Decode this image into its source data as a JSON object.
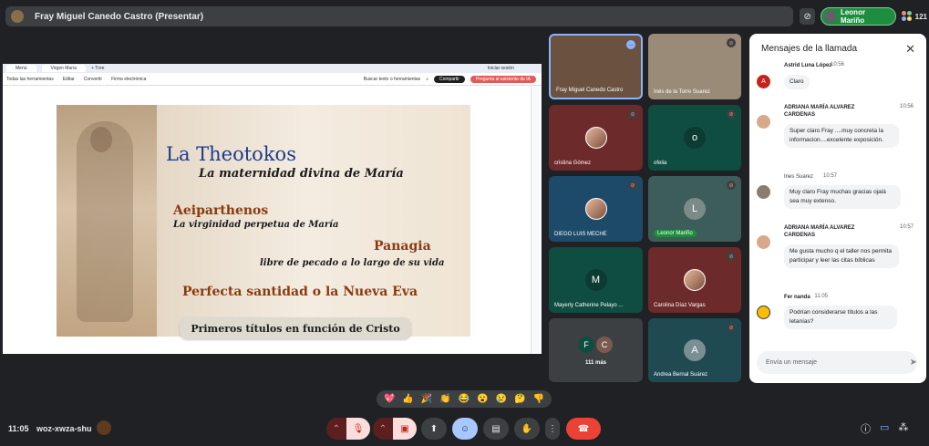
{
  "top_bar": {
    "presenter_label": "Fray Miguel Canedo Castro (Presentar)",
    "self_name": "Leonor Mariño",
    "participant_count": "121"
  },
  "shared_screen": {
    "browser_tabs": [
      "Menú",
      "Virgen María",
      "+ Tree",
      "Iniciar sesión"
    ],
    "toolbar_items": [
      "Todas las herramientas",
      "Editar",
      "Convertir",
      "Firma electrónica"
    ],
    "search_placeholder": "Buscar texto o herramientas",
    "share_button": "Compartir",
    "ai_button": "Pregunta al asistente de IA",
    "slide": {
      "title": "La Theotokos",
      "subtitle": "La maternidad divina de María",
      "item1_title": "Aeiparthenos",
      "item1_sub": "La virginidad perpetua de María",
      "item2_title": "Panagia",
      "item2_sub": "libre de pecado a lo largo de su vida",
      "item3_title": "Perfecta santidad o la Nueva Eva",
      "footer": "Primeros títulos en función de Cristo"
    }
  },
  "tiles": [
    {
      "name": "Fray Miguel Canedo Castro",
      "initial": "",
      "bg": "#6b5240",
      "muted": false
    },
    {
      "name": "Inés de la Torre Suarez",
      "initial": "",
      "bg": "#9a8a78",
      "muted": true
    },
    {
      "name": "cristina Gómez",
      "initial": "",
      "bg": "#6d2a2a",
      "muted": true
    },
    {
      "name": "ofelia",
      "initial": "o",
      "bg": "#0f4d40",
      "muted": true
    },
    {
      "name": "DIEGO LUIS MECHE",
      "initial": "",
      "bg": "#1e4a6a",
      "muted": true
    },
    {
      "name": "Leonor Mariño",
      "initial": "L",
      "bg": "#3c5d5a",
      "muted": true
    },
    {
      "name": "Mayerly Catherine Pelayo ...",
      "initial": "M",
      "bg": "#0f4d40",
      "muted": false
    },
    {
      "name": "Carolina Díaz Vargas",
      "initial": "",
      "bg": "#6d2a2a",
      "muted": true
    },
    {
      "name": "111 más",
      "initial": "",
      "bg": "#3c4043",
      "muted": false
    },
    {
      "name": "Andrea Bernal Suárez",
      "initial": "A",
      "bg": "#1f4a52",
      "muted": true
    }
  ],
  "chat": {
    "title": "Mensajes de la llamada",
    "messages": [
      {
        "sender": "Astrid Luna López",
        "time": "10:56",
        "text": "Claro",
        "avatar_letter": "A"
      },
      {
        "sender": "ADRIANA MARÍA ALVAREZ CARDENAS",
        "time": "10:56",
        "text": "Super claro Fray ....muy concreta la informacion....excelente exposición."
      },
      {
        "sender": "Ines Suarez",
        "time": "10:57",
        "text": "Muy claro Fray muchas gracias ojalá sea muy extenso."
      },
      {
        "sender": "ADRIANA MARÍA ALVAREZ CARDENAS",
        "time": "10:57",
        "text": "Me gusta mucho q el taller nos permita participar y leer las citas bíblicas"
      },
      {
        "sender": "Fer nanda",
        "time": "11:05",
        "text": "Podrían considerarse títulos a las letanías?"
      }
    ],
    "input_placeholder": "Envía un mensaje"
  },
  "reactions": [
    "💖",
    "👍",
    "🎉",
    "👏",
    "😂",
    "😮",
    "😢",
    "🤔",
    "👎"
  ],
  "bottom_bar": {
    "time": "11:05",
    "meeting_code": "woz-xwza-shu"
  },
  "colors": {
    "end_call": "#ea4335",
    "muted_red": "#5c1f1f",
    "active_blue": "#a8c7fa",
    "self_green": "#1e8e3e"
  }
}
